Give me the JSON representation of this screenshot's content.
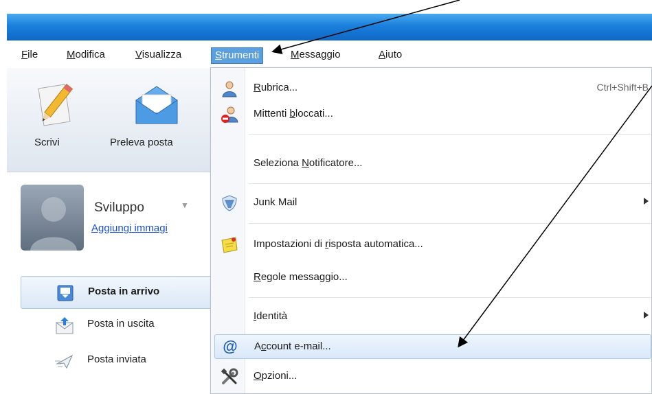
{
  "menubar": {
    "items": [
      {
        "label": "File",
        "ul": "F",
        "rest": "ile"
      },
      {
        "label": "Modifica",
        "ul": "M",
        "rest": "odifica"
      },
      {
        "label": "Visualizza",
        "ul": "V",
        "rest": "isualizza"
      },
      {
        "label": "Strumenti",
        "ul": "S",
        "rest": "trumenti"
      },
      {
        "label": "Messaggio",
        "ul": "M",
        "rest": "essaggio"
      },
      {
        "label": "Aiuto",
        "ul": "A",
        "rest": "iuto"
      }
    ],
    "active_index": 3
  },
  "toolbar": {
    "write_label": "Scrivi",
    "fetch_label": "Preleva posta"
  },
  "profile": {
    "name": "Sviluppo",
    "add_image_link": "Aggiungi immagi"
  },
  "folders": [
    {
      "label": "Posta in arrivo",
      "selected": true,
      "icon": "inbox-icon"
    },
    {
      "label": "Posta in uscita",
      "selected": false,
      "icon": "outbox-icon"
    },
    {
      "label": "Posta inviata",
      "selected": false,
      "icon": "sent-icon"
    }
  ],
  "dropdown": {
    "items": [
      {
        "pre": "",
        "ul": "R",
        "post": "ubrica...",
        "shortcut": "Ctrl+Shift+B",
        "icon": "contacts-icon"
      },
      {
        "pre": "Mittenti ",
        "ul": "b",
        "post": "loccati...",
        "icon": "blocked-senders-icon"
      },
      {
        "pre": "Seleziona ",
        "ul": "N",
        "post": "otificatore...",
        "icon": ""
      },
      {
        "pre": "Junk Mail",
        "ul": "",
        "post": "",
        "submenu": true,
        "icon": "junk-shield-icon"
      },
      {
        "pre": "Impostazioni di ",
        "ul": "r",
        "post": "isposta automatica...",
        "icon": "auto-reply-note-icon"
      },
      {
        "pre": "",
        "ul": "R",
        "post": "egole messaggio...",
        "icon": ""
      },
      {
        "pre": "",
        "ul": "I",
        "post": "dentità",
        "submenu": true,
        "icon": ""
      },
      {
        "pre": "A",
        "ul": "c",
        "post": "count e-mail...",
        "highlighted": true,
        "icon": "at-sign-icon"
      },
      {
        "pre": "",
        "ul": "O",
        "post": "pzioni...",
        "icon": "tools-icon"
      }
    ]
  },
  "colors": {
    "titlebar": "#1a7fdc",
    "menu_active": "#5a9fe0",
    "link": "#1a4fd8",
    "arrow": "#000000"
  }
}
